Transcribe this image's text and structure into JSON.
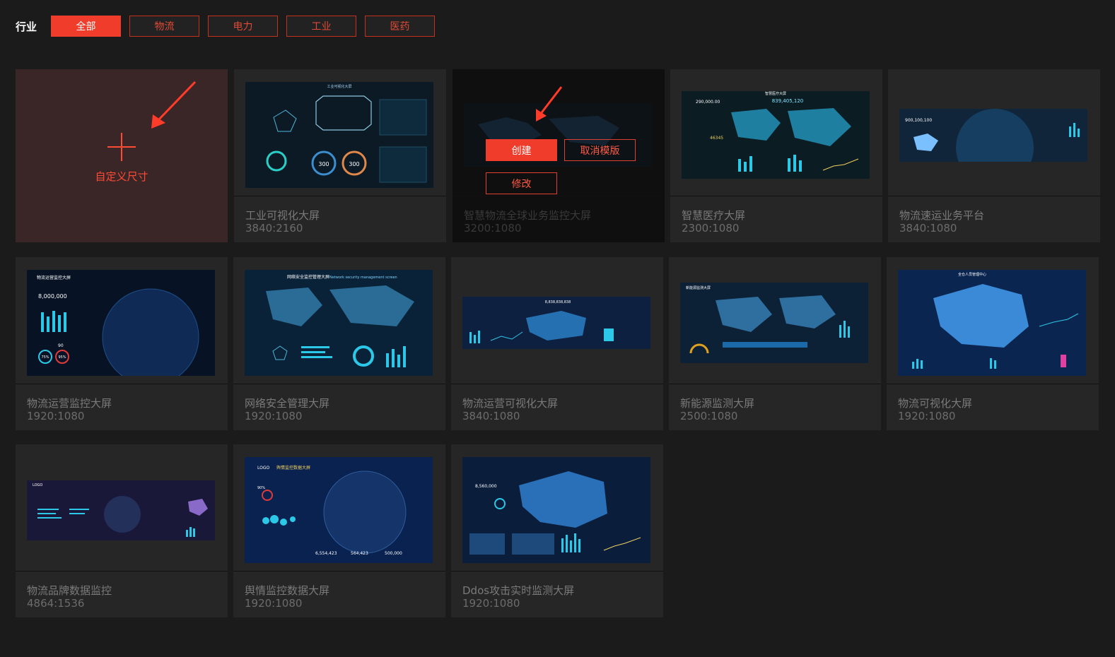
{
  "filter": {
    "label": "行业",
    "options": [
      {
        "label": "全部",
        "active": true
      },
      {
        "label": "物流",
        "active": false
      },
      {
        "label": "电力",
        "active": false
      },
      {
        "label": "工业",
        "active": false
      },
      {
        "label": "医药",
        "active": false
      }
    ]
  },
  "custom": {
    "label": "自定义尺寸"
  },
  "hover_actions": {
    "create": "创建",
    "cancel_template": "取消模版",
    "edit": "修改"
  },
  "templates": [
    {
      "title": "工业可视化大屏",
      "size": "3840:2160",
      "thumb": {
        "header": "工业可视化大屏",
        "n1": "300",
        "n2": "300"
      }
    },
    {
      "title": "智慧物流全球业务监控大屏",
      "size": "3200:1080"
    },
    {
      "title": "智慧医疗大屏",
      "size": "2300:1080",
      "thumb": {
        "header": "智慧医疗大屏",
        "counter": "839,405,120",
        "v1": "290,000.00",
        "v2": "46345"
      }
    },
    {
      "title": "物流速运业务平台",
      "size": "3840:1080",
      "thumb": {
        "v1": "900,100,100"
      }
    },
    {
      "title": "物流运营监控大屏",
      "size": "1920:1080",
      "thumb": {
        "header": "物流运营监控大屏",
        "v1": "8,000,000",
        "p1": "75%",
        "p2": "95%",
        "n": "90"
      }
    },
    {
      "title": "网络安全管理大屏",
      "size": "1920:1080",
      "thumb": {
        "header": "网络安全监控管理大屏",
        "sub": "Network security management screen"
      }
    },
    {
      "title": "物流运营可视化大屏",
      "size": "3840:1080",
      "thumb": {
        "counter": "8,838,838,838"
      }
    },
    {
      "title": "新能源监测大屏",
      "size": "2500:1080",
      "thumb": {
        "header": "新能源监测大屏"
      }
    },
    {
      "title": "物流可视化大屏",
      "size": "1920:1080",
      "thumb": {
        "header": "全仓人员管理中心"
      }
    },
    {
      "title": "物流品牌数据监控",
      "size": "4864:1536",
      "thumb": {
        "logo": "LOGO"
      }
    },
    {
      "title": "舆情监控数据大屏",
      "size": "1920:1080",
      "thumb": {
        "logo": "LOGO",
        "header": "舆情监控数据大屏",
        "v1": "6,554,423",
        "v2": "564,423",
        "v3": "500,000",
        "p": "90%"
      }
    },
    {
      "title": "Ddos攻击实时监测大屏",
      "size": "1920:1080",
      "thumb": {
        "counter": "8,560,000"
      }
    }
  ],
  "colors": {
    "accent": "#f03c2b",
    "bg": "#1b1b1b",
    "card": "#262626"
  }
}
